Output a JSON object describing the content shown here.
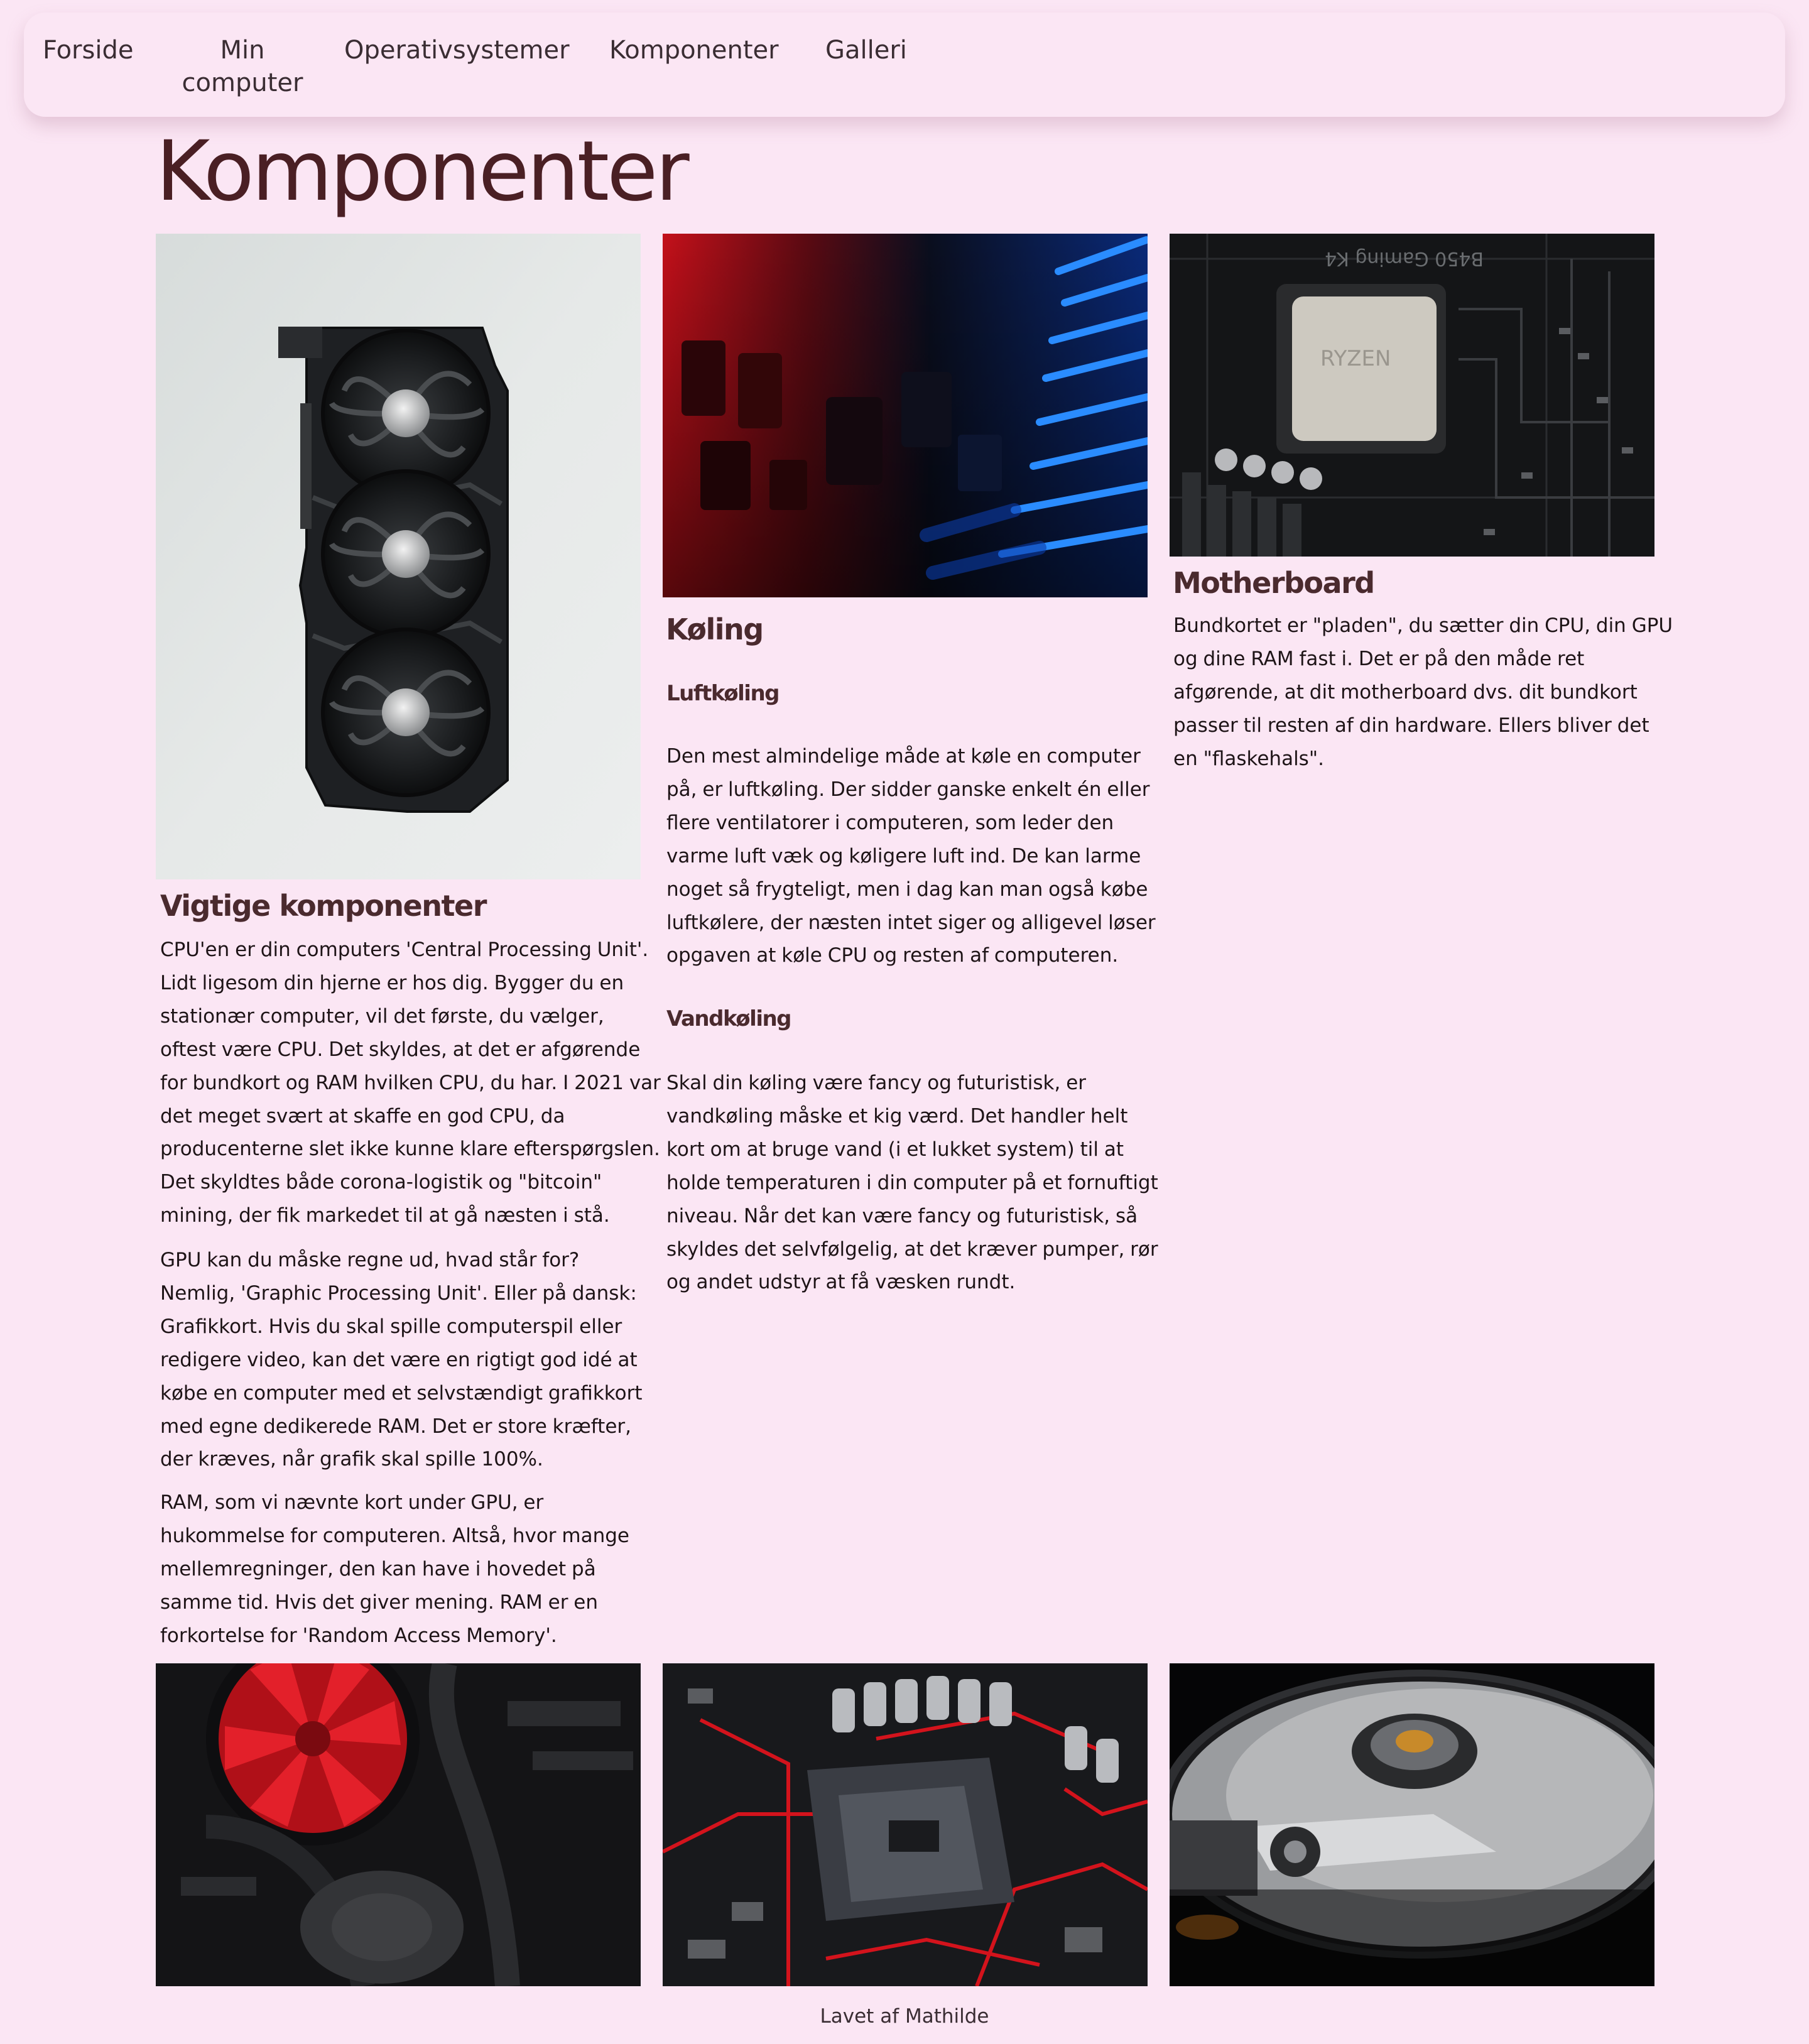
{
  "nav": {
    "items": [
      {
        "label": "Forside"
      },
      {
        "label_lines": [
          "Min",
          "computer"
        ]
      },
      {
        "label": "Operativsystemer"
      },
      {
        "label": "Komponenter"
      },
      {
        "label": "Galleri"
      }
    ]
  },
  "page": {
    "title": "Komponenter"
  },
  "sections": {
    "vigtige": {
      "heading": "Vigtige komponenter",
      "paragraphs": [
        [
          "CPU'en er din computers 'Central Processing Unit'.",
          "Lidt ligesom din hjerne er hos dig. Bygger du en",
          "stationær computer, vil det første, du vælger,",
          "oftest være CPU. Det skyldes, at det er afgørende",
          "for bundkort og RAM hvilken CPU, du har. I 2021 var",
          "det meget svært at skaffe en god CPU, da",
          "producenterne slet ikke kunne klare efterspørgslen.",
          "Det skyldtes både corona-logistik og \"bitcoin\"",
          "mining, der fik markedet til at gå næsten i stå."
        ],
        [
          "GPU kan du måske regne ud, hvad står for?",
          "Nemlig, 'Graphic Processing Unit'. Eller på dansk:",
          "Grafikkort. Hvis du skal spille computerspil eller",
          "redigere video, kan det være en rigtigt god idé at",
          "købe en computer med et selvstændigt grafikkort",
          "med egne dedikerede RAM. Det er store kræfter,",
          "der kræves, når grafik skal spille 100%."
        ],
        [
          "RAM, som vi nævnte kort under GPU, er",
          "hukommelse for computeren. Altså, hvor mange",
          "mellemregninger, den kan have i hovedet på",
          "samme tid. Hvis det giver mening. RAM er en",
          "forkortelse for 'Random Access Memory'."
        ]
      ]
    },
    "koling": {
      "heading": "Køling",
      "luft_heading": "Luftkøling",
      "luft_paragraph": [
        "Den mest almindelige måde at køle en computer",
        "på, er luftkøling. Der sidder ganske enkelt én eller",
        "flere ventilatorer i computeren, som leder den",
        "varme luft væk og køligere luft ind. De kan larme",
        "noget så frygteligt, men i dag kan man også købe",
        "luftkølere, der næsten intet siger og alligevel løser",
        "opgaven at køle CPU og resten af computeren."
      ],
      "vand_heading": "Vandkøling",
      "vand_paragraph": [
        "Skal din køling være fancy og futuristisk, er",
        "vandkøling måske et kig værd. Det handler helt",
        "kort om at bruge vand (i et lukket system) til at",
        "holde temperaturen i din computer på et fornuftigt",
        "niveau. Når det kan være fancy og futuristisk, så",
        "skyldes det selvfølgelig, at det kræver pumper, rør",
        "og andet udstyr at få væsken rundt."
      ]
    },
    "motherboard": {
      "heading": "Motherboard",
      "paragraph": [
        "Bundkortet er \"pladen\", du sætter din CPU, din GPU",
        "og dine RAM fast i. Det er på den måde ret",
        "afgørende, at dit motherboard dvs. dit bundkort",
        "passer til resten af din hardware. Ellers bliver det",
        "en \"flaskehals\"."
      ]
    }
  },
  "images": {
    "gpu_photo": "graphics-card-photo",
    "cooling_photo": "red-blue-circuit-photo",
    "motherboard_photo": "ryzen-cpu-motherboard-photo",
    "fan_photo": "red-cpu-fan-photo",
    "socket_photo": "cpu-socket-photo",
    "harddisk_photo": "hard-disk-photo",
    "board_text": "B450 Gaming K4",
    "cpu_text": "RYZEN"
  },
  "footer": {
    "text": "Lavet af Mathilde"
  },
  "colors": {
    "background": "#fbe6f4",
    "title": "#4a1f24",
    "heading": "#4a2a2e",
    "text": "#1e1417"
  }
}
